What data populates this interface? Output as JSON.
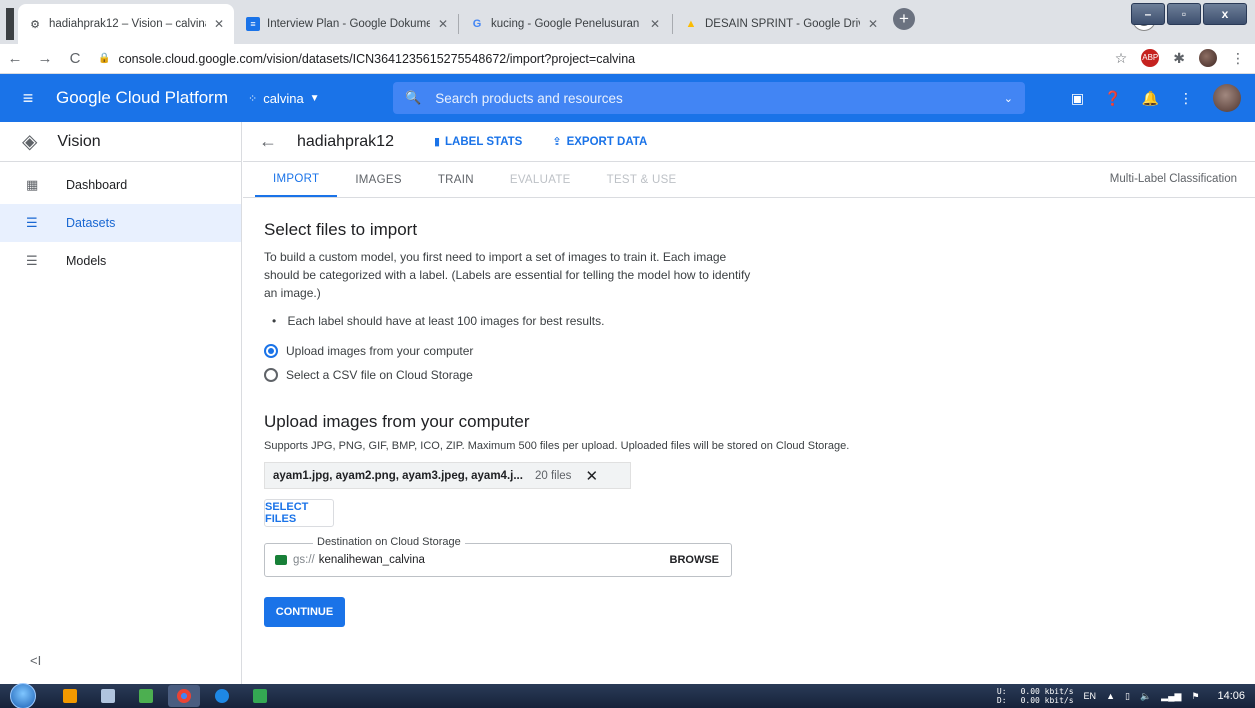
{
  "browser": {
    "tabs": [
      {
        "title": "hadiahprak12 – Vision – calvina –",
        "icon": "gear-icon"
      },
      {
        "title": "Interview Plan - Google Dokume",
        "icon": "docs-icon"
      },
      {
        "title": "kucing - Google Penelusuran",
        "icon": "google-icon"
      },
      {
        "title": "DESAIN SPRINT - Google Drive",
        "icon": "drive-icon"
      }
    ],
    "url": "console.cloud.google.com/vision/datasets/ICN3641235615275548672/import?project=calvina"
  },
  "header": {
    "title": "Google Cloud Platform",
    "project": "calvina",
    "search_placeholder": "Search products and resources"
  },
  "sidebar": {
    "product": "Vision",
    "items": [
      {
        "label": "Dashboard"
      },
      {
        "label": "Datasets"
      },
      {
        "label": "Models"
      }
    ]
  },
  "dataset": {
    "name": "hadiahprak12",
    "label_stats": "LABEL STATS",
    "export_data": "EXPORT DATA"
  },
  "tabs": [
    "IMPORT",
    "IMAGES",
    "TRAIN",
    "EVALUATE",
    "TEST & USE"
  ],
  "classification": "Multi-Label Classification",
  "import": {
    "heading": "Select files to import",
    "description": "To build a custom model, you first need to import a set of images to train it. Each image should be categorized with a label. (Labels are essential for telling the model how to identify an image.)",
    "bullet": "Each label should have at least 100 images for best results.",
    "option_upload": "Upload images from your computer",
    "option_csv": "Select a CSV file on Cloud Storage"
  },
  "upload": {
    "heading": "Upload images from your computer",
    "supports": "Supports JPG, PNG, GIF, BMP, ICO, ZIP. Maximum 500 files per upload. Uploaded files will be stored on Cloud Storage.",
    "file_names": "ayam1.jpg, ayam2.png, ayam3.jpeg, ayam4.j...",
    "file_count": "20 files",
    "select_files": "SELECT FILES",
    "destination_label": "Destination on Cloud Storage",
    "gs_prefix": "gs://",
    "bucket": "kenalihewan_calvina",
    "browse": "BROWSE",
    "continue": "CONTINUE"
  },
  "taskbar": {
    "net_up": "0.00 kbit/s",
    "net_down": "0.00 kbit/s",
    "up_label": "U:",
    "down_label": "D:",
    "lang": "EN",
    "time": "14:06"
  }
}
